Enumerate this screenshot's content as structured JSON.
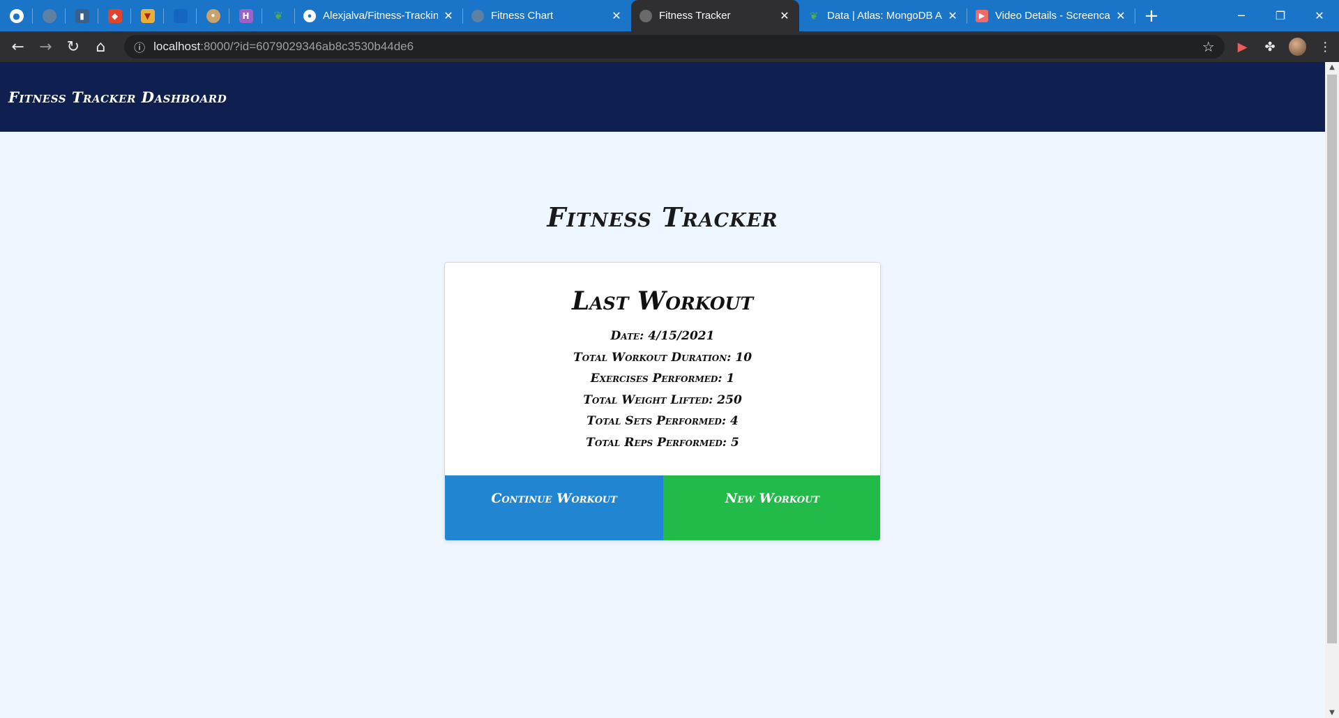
{
  "browser": {
    "pinned_tabs": [
      {
        "icon": "github-icon"
      },
      {
        "icon": "globe-icon"
      },
      {
        "icon": "bar-chart-icon"
      },
      {
        "icon": "gitlab-icon"
      },
      {
        "icon": "shield-icon"
      },
      {
        "icon": "blue-square-icon"
      },
      {
        "icon": "robot-icon"
      },
      {
        "icon": "heroku-icon"
      },
      {
        "icon": "mongodb-leaf-icon"
      }
    ],
    "tabs": [
      {
        "title": "Alexjalva/Fitness-Trackin",
        "icon": "github-icon"
      },
      {
        "title": "Fitness Chart",
        "icon": "globe-icon"
      },
      {
        "title": "Fitness Tracker",
        "icon": "globe-icon",
        "active": true
      },
      {
        "title": "Data | Atlas: MongoDB A",
        "icon": "mongodb-leaf-icon"
      },
      {
        "title": "Video Details - Screenca",
        "icon": "screencastify-icon"
      }
    ],
    "close_glyph": "✕",
    "new_tab_glyph": "+",
    "url_host": "localhost",
    "url_path": ":8000/?id=6079029346ab8c3530b44de6",
    "accent_color": "#1a74c8"
  },
  "navbar": {
    "brand": "Fitness Tracker Dashboard",
    "background": "#0f1f4f"
  },
  "page": {
    "heading": "Fitness Tracker"
  },
  "card": {
    "title": "Last Workout",
    "stats": [
      "Date: 4/15/2021",
      "Total Workout Duration: 10",
      "Exercises Performed: 1",
      "Total Weight Lifted: 250",
      "Total Sets Performed: 4",
      "Total Reps Performed: 5"
    ],
    "buttons": {
      "continue": "Continue Workout",
      "new": "New Workout"
    },
    "button_colors": {
      "continue": "#2285d2",
      "new": "#22bb4a"
    }
  }
}
